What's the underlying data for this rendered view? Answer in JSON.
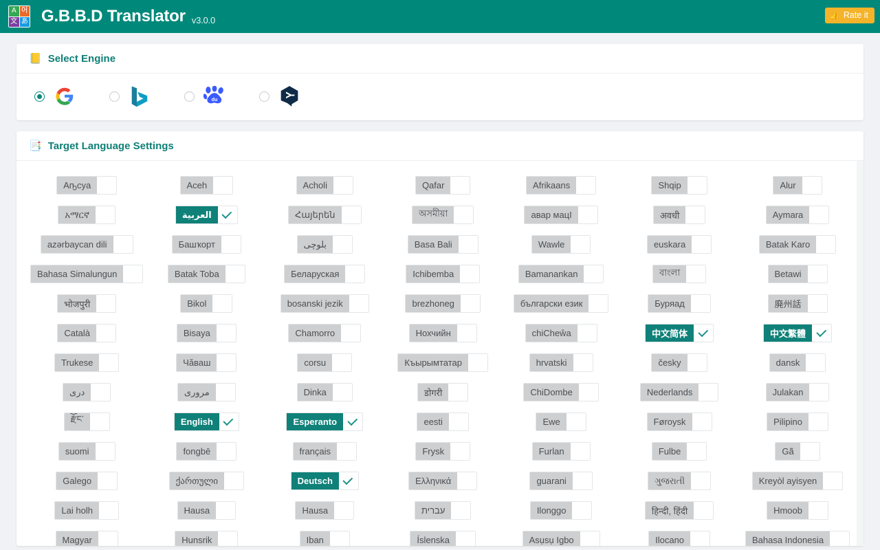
{
  "header": {
    "app_title": "G.B.B.D Translator",
    "version": "v3.0.0",
    "rate_label": "Rate it",
    "rate_icon": "thumbs-up-icon",
    "logo_cells": [
      "A",
      "어",
      "文",
      "あ"
    ],
    "brand_color": "#00897b",
    "rate_color": "#f5b32a"
  },
  "engine_section": {
    "emoji": "📒",
    "title": "Select Engine",
    "engines": [
      {
        "name": "google",
        "selected": true
      },
      {
        "name": "bing",
        "selected": false
      },
      {
        "name": "baidu",
        "selected": false
      },
      {
        "name": "deepl",
        "selected": false
      }
    ]
  },
  "language_section": {
    "emoji": "📑",
    "title": "Target Language Settings",
    "columns": 7,
    "languages": [
      {
        "label": "Аҧcya",
        "selected": false
      },
      {
        "label": "Aceh",
        "selected": false
      },
      {
        "label": "Acholi",
        "selected": false
      },
      {
        "label": "Qafar",
        "selected": false
      },
      {
        "label": "Afrikaans",
        "selected": false
      },
      {
        "label": "Shqip",
        "selected": false
      },
      {
        "label": "Alur",
        "selected": false
      },
      {
        "label": "አማርኛ",
        "selected": false
      },
      {
        "label": "العربية",
        "selected": true
      },
      {
        "label": "Հայերեն",
        "selected": false
      },
      {
        "label": "অসমীয়া",
        "selected": false
      },
      {
        "label": "авар мацӀ",
        "selected": false
      },
      {
        "label": "अवधी",
        "selected": false
      },
      {
        "label": "Aymara",
        "selected": false
      },
      {
        "label": "azərbaycan dili",
        "selected": false
      },
      {
        "label": "Башҡорт",
        "selected": false
      },
      {
        "label": "بلوچی",
        "selected": false
      },
      {
        "label": "Basa Bali",
        "selected": false
      },
      {
        "label": "Wawle",
        "selected": false
      },
      {
        "label": "euskara",
        "selected": false
      },
      {
        "label": "Batak Karo",
        "selected": false
      },
      {
        "label": "Bahasa Simalungun",
        "selected": false
      },
      {
        "label": "Batak Toba",
        "selected": false
      },
      {
        "label": "Беларуская",
        "selected": false
      },
      {
        "label": "Ichibemba",
        "selected": false
      },
      {
        "label": "Bamanankan",
        "selected": false
      },
      {
        "label": "বাংলা",
        "selected": false
      },
      {
        "label": "Betawi",
        "selected": false
      },
      {
        "label": "भोजपुरी",
        "selected": false
      },
      {
        "label": "Bikol",
        "selected": false
      },
      {
        "label": "bosanski jezik",
        "selected": false
      },
      {
        "label": "brezhoneg",
        "selected": false
      },
      {
        "label": "български език",
        "selected": false
      },
      {
        "label": "Буряад",
        "selected": false
      },
      {
        "label": "廃州話",
        "selected": false
      },
      {
        "label": "Català",
        "selected": false
      },
      {
        "label": "Bisaya",
        "selected": false
      },
      {
        "label": "Chamorro",
        "selected": false
      },
      {
        "label": "Нохчийн",
        "selected": false
      },
      {
        "label": "chiCheŵa",
        "selected": false
      },
      {
        "label": "中文简体",
        "selected": true
      },
      {
        "label": "中文繁體",
        "selected": true
      },
      {
        "label": "Trukese",
        "selected": false
      },
      {
        "label": "Чӑваш",
        "selected": false
      },
      {
        "label": "corsu",
        "selected": false
      },
      {
        "label": "Къырымтатар",
        "selected": false
      },
      {
        "label": "hrvatski",
        "selected": false
      },
      {
        "label": "česky",
        "selected": false
      },
      {
        "label": "dansk",
        "selected": false
      },
      {
        "label": "دری",
        "selected": false
      },
      {
        "label": "مروری",
        "selected": false
      },
      {
        "label": "Dinka",
        "selected": false
      },
      {
        "label": "डोगरी",
        "selected": false
      },
      {
        "label": "ChiDombe",
        "selected": false
      },
      {
        "label": "Nederlands",
        "selected": false
      },
      {
        "label": "Julakan",
        "selected": false
      },
      {
        "label": "རྫོང་",
        "selected": false
      },
      {
        "label": "English",
        "selected": true
      },
      {
        "label": "Esperanto",
        "selected": true
      },
      {
        "label": "eesti",
        "selected": false
      },
      {
        "label": "Ewe",
        "selected": false
      },
      {
        "label": "Føroysk",
        "selected": false
      },
      {
        "label": "Pilipino",
        "selected": false
      },
      {
        "label": "suomi",
        "selected": false
      },
      {
        "label": "fongbē",
        "selected": false
      },
      {
        "label": "français",
        "selected": false
      },
      {
        "label": "Frysk",
        "selected": false
      },
      {
        "label": "Furlan",
        "selected": false
      },
      {
        "label": "Fulbe",
        "selected": false
      },
      {
        "label": "Gã",
        "selected": false
      },
      {
        "label": "Galego",
        "selected": false
      },
      {
        "label": "ქართული",
        "selected": false
      },
      {
        "label": "Deutsch",
        "selected": true
      },
      {
        "label": "Ελληνικά",
        "selected": false
      },
      {
        "label": "guarani",
        "selected": false
      },
      {
        "label": "ગુજરાતી",
        "selected": false
      },
      {
        "label": "Kreyòl ayisyen",
        "selected": false
      },
      {
        "label": "Lai holh",
        "selected": false
      },
      {
        "label": "Hausa",
        "selected": false
      },
      {
        "label": "Hausa",
        "selected": false
      },
      {
        "label": "עברית",
        "selected": false
      },
      {
        "label": "Ilonggo",
        "selected": false
      },
      {
        "label": "हिन्दी, हिंदी",
        "selected": false
      },
      {
        "label": "Hmoob",
        "selected": false
      },
      {
        "label": "Magyar",
        "selected": false
      },
      {
        "label": "Hunsrik",
        "selected": false
      },
      {
        "label": "Iban",
        "selected": false
      },
      {
        "label": "Íslenska",
        "selected": false
      },
      {
        "label": "Asụsụ Igbo",
        "selected": false
      },
      {
        "label": "Ilocano",
        "selected": false
      },
      {
        "label": "Bahasa Indonesia",
        "selected": false
      }
    ]
  }
}
